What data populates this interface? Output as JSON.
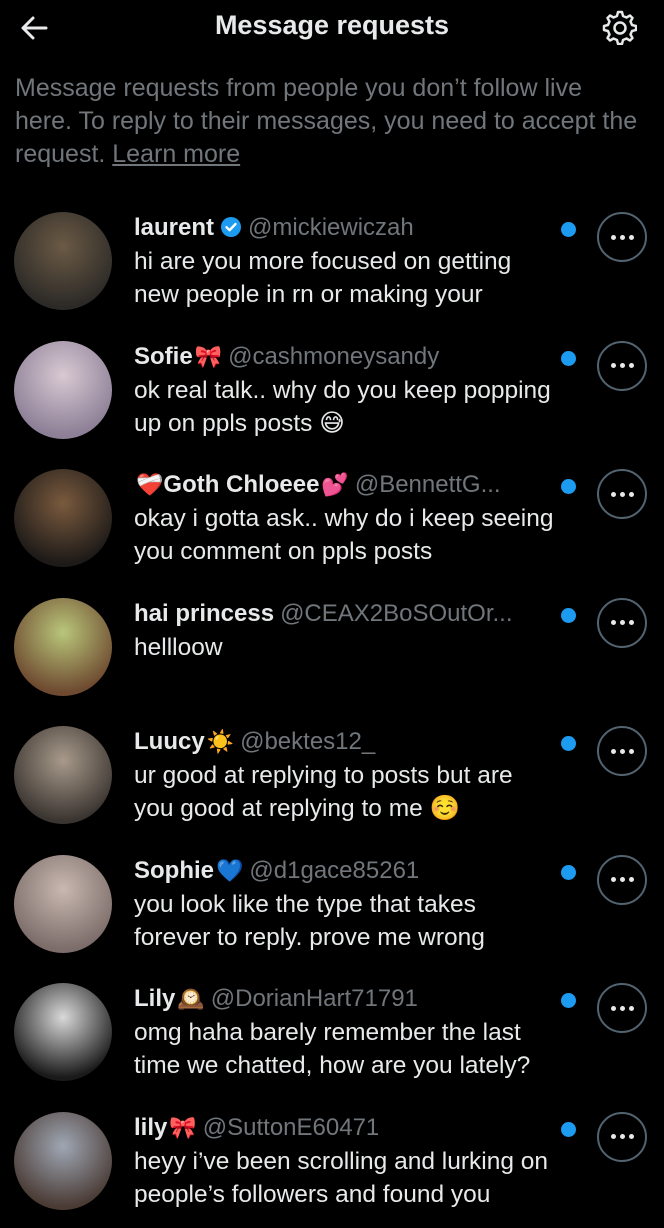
{
  "header": {
    "title": "Message requests",
    "back_icon": "arrow-left-icon",
    "settings_icon": "gear-icon"
  },
  "intro": {
    "text": "Message requests from people you don’t follow live here. To reply to their messages, you need to accept the request. ",
    "learn_more": "Learn more"
  },
  "colors": {
    "background": "#000000",
    "text": "#e7e9ea",
    "secondary": "#71767b",
    "accent": "#1d9bf0",
    "border": "#536471"
  },
  "requests": [
    {
      "name": "laurent",
      "emoji": "",
      "verified": true,
      "handle": "@mickiewiczah",
      "message": "hi are you more focused on getting new people in rn or making your",
      "unread": true,
      "avatar_colors": [
        "#6b5a45",
        "#2c2a27"
      ]
    },
    {
      "name": "Sofie",
      "emoji": "🎀",
      "verified": false,
      "handle": "@cashmoneysandy",
      "message": "ok real talk.. why do you keep popping up on ppls posts 😅",
      "unread": true,
      "avatar_colors": [
        "#d8c9d2",
        "#8c7f96"
      ]
    },
    {
      "name": "Goth Chloeee",
      "emoji": "💕",
      "prefix_emoji": "❤️‍🩹",
      "verified": false,
      "handle": "@BennettG...",
      "message": "okay i gotta ask.. why do i keep seeing you comment on ppls posts",
      "unread": true,
      "avatar_colors": [
        "#7a5a3e",
        "#1d1a18"
      ]
    },
    {
      "name": "hai princess",
      "emoji": "",
      "verified": false,
      "handle": "@CEAX2BoSOutOr...",
      "message": "hellloow",
      "unread": true,
      "avatar_colors": [
        "#b9c67a",
        "#6e4a30"
      ]
    },
    {
      "name": "Luucy",
      "emoji": "☀️",
      "verified": false,
      "handle": "@bektes12_",
      "message": "ur good at replying to posts but are you good at replying to me ☺️",
      "unread": true,
      "avatar_colors": [
        "#a89a8b",
        "#3b3531"
      ]
    },
    {
      "name": "Sophie",
      "emoji": "💙",
      "verified": false,
      "handle": "@d1gace85261",
      "message": "you look like the type that takes forever to reply. prove me wrong",
      "unread": true,
      "avatar_colors": [
        "#c9b8b0",
        "#7c6d6a"
      ]
    },
    {
      "name": "Lily",
      "emoji": "🕰️",
      "verified": false,
      "handle": "@DorianHart71791",
      "message": "omg haha barely remember the last time we chatted, how are you lately?",
      "unread": true,
      "avatar_colors": [
        "#d9d9d9",
        "#1a1a1a"
      ]
    },
    {
      "name": "lily",
      "emoji": "🎀",
      "verified": false,
      "handle": "@SuttonE60471",
      "message": "heyy i’ve been scrolling and lurking on people’s followers and found you",
      "unread": true,
      "avatar_colors": [
        "#9fa7b4",
        "#4a3b35"
      ]
    }
  ]
}
